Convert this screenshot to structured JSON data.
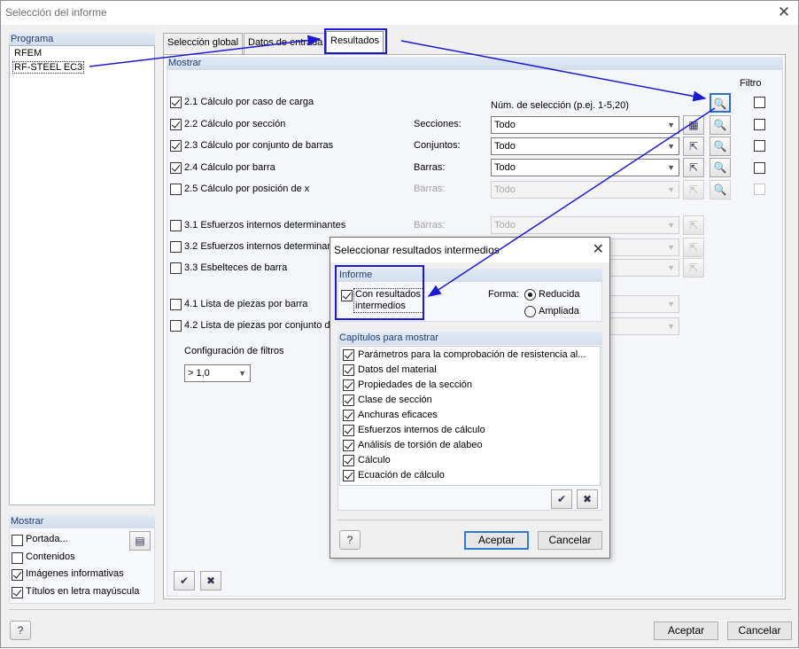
{
  "window": {
    "title": "Selección del informe",
    "close_icon": "close-icon"
  },
  "programa": {
    "header": "Programa",
    "items": [
      "RFEM",
      "RF-STEEL EC3"
    ],
    "selected_index": 1
  },
  "mostrar_left": {
    "header": "Mostrar",
    "items": [
      {
        "label": "Portada...",
        "checked": false
      },
      {
        "label": "Contenidos",
        "checked": false
      },
      {
        "label": "Imágenes informativas",
        "checked": true
      },
      {
        "label": "Títulos en letra mayúscula",
        "checked": true
      }
    ]
  },
  "tabs": [
    "Selección global",
    "Datos de entrada",
    "Resultados"
  ],
  "active_tab": 2,
  "mostrar_right": {
    "header": "Mostrar",
    "filtro": "Filtro",
    "num_seleccion": "Núm. de selección (p.ej. 1-5,20)",
    "rows": [
      {
        "label": "2.1 Cálculo por caso de carga",
        "checked": true,
        "field": "",
        "value": "",
        "enabled": true
      },
      {
        "label": "2.2 Cálculo por sección",
        "checked": true,
        "field": "Secciones:",
        "value": "Todo",
        "enabled": true
      },
      {
        "label": "2.3 Cálculo por conjunto de barras",
        "checked": true,
        "field": "Conjuntos:",
        "value": "Todo",
        "enabled": true
      },
      {
        "label": "2.4 Cálculo por barra",
        "checked": true,
        "field": "Barras:",
        "value": "Todo",
        "enabled": true
      },
      {
        "label": "2.5 Cálculo por posición de x",
        "checked": false,
        "field": "Barras:",
        "value": "Todo",
        "enabled": false
      },
      {
        "label": "3.1 Esfuerzos internos determinantes",
        "checked": false,
        "field": "Barras:",
        "value": "Todo",
        "enabled": false
      },
      {
        "label": "3.2 Esfuerzos internos determinan",
        "checked": false
      },
      {
        "label": "3.3 Esbelteces de barra",
        "checked": false
      },
      {
        "label": "4.1 Lista de piezas por barra",
        "checked": false
      },
      {
        "label": "4.2 Lista de piezas por conjunto de",
        "checked": false
      }
    ],
    "config_filtros": "Configuración de filtros",
    "config_value": "> 1,0"
  },
  "footer": {
    "ok": "Aceptar",
    "cancel": "Cancelar"
  },
  "dialog": {
    "title": "Seleccionar resultados intermedios",
    "informe_header": "Informe",
    "con_resultados": "Con resultados intermedios",
    "forma_label": "Forma:",
    "forma_options": [
      "Reducida",
      "Ampliada"
    ],
    "forma_selected": 0,
    "capitulos_header": "Capítulos para mostrar",
    "capitulos": [
      "Parámetros para la comprobación de resistencia al...",
      "Datos del material",
      "Propiedades de la sección",
      "Clase de sección",
      "Anchuras eficaces",
      "Esfuerzos internos de cálculo",
      "Análisis de torsión de alabeo",
      "Cálculo",
      "Ecuación de cálculo"
    ],
    "ok": "Aceptar",
    "cancel": "Cancelar"
  },
  "colors": {
    "annotation": "#1a1ad0",
    "section_header": "#1f3d73",
    "default_button": "#2e7ad1"
  }
}
